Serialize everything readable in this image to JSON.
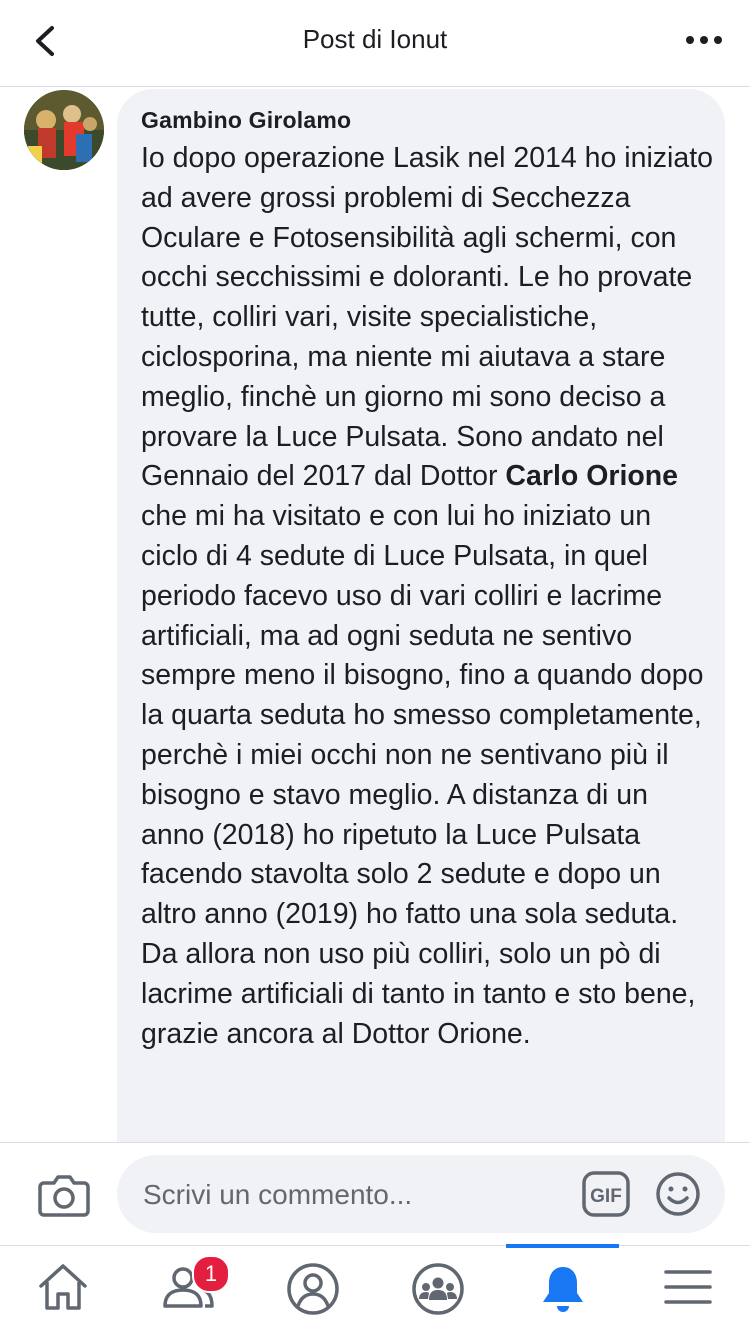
{
  "header": {
    "title": "Post di Ionut"
  },
  "comment": {
    "author": "Gambino Girolamo",
    "text_part1": "Io dopo operazione Lasik nel 2014 ho iniziato ad avere grossi problemi di Secchezza Oculare e Fotosensibilità agli schermi, con occhi secchissimi e doloranti. Le ho provate tutte, colliri vari, visite specialistiche, ciclosporina, ma niente mi aiutava a stare meglio, finchè un giorno mi sono deciso a provare la Luce Pulsata. Sono andato nel Gennaio del 2017 dal Dottor ",
    "text_bold": "Carlo Orione",
    "text_part2": " che mi ha visitato e con lui ho iniziato un ciclo di 4 sedute di Luce Pulsata, in quel periodo facevo uso di vari colliri e lacrime artificiali, ma ad ogni seduta ne sentivo sempre meno il bisogno, fino a quando dopo la quarta seduta ho smesso completamente, perchè i miei occhi non ne sentivano più il bisogno e stavo meglio. A distanza di un anno (2018) ho ripetuto la Luce Pulsata facendo stavolta solo 2 sedute e dopo un altro anno (2019) ho fatto una sola seduta. Da allora non uso più colliri, solo un pò di lacrime artificiali di tanto in tanto e sto bene, grazie ancora al Dottor Orione."
  },
  "composer": {
    "placeholder": "Scrivi un commento...",
    "gif_label": "GIF"
  },
  "nav": {
    "friends_badge": "1",
    "active_tab": "notifications"
  },
  "colors": {
    "accent": "#1877f2",
    "badge": "#e41e3f",
    "bubble": "#f0f2f5",
    "icon": "#606770"
  }
}
